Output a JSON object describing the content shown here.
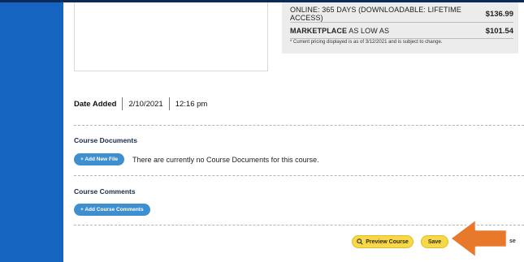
{
  "pricing": {
    "rows": [
      {
        "label_bold": "",
        "label": "ONLINE: 365 DAYS (DOWNLOADABLE: LIFETIME ACCESS)",
        "amount": "$136.99"
      },
      {
        "label_bold": "MARKETPLACE",
        "label": " AS LOW AS",
        "amount": "$101.54"
      }
    ],
    "note": "* Current pricing displayed is as of 3/12/2021 and is subject to change."
  },
  "date_added": {
    "label": "Date Added",
    "date": "2/10/2021",
    "time": "12:16 pm"
  },
  "documents": {
    "title": "Course Documents",
    "add_button": "+ Add New File",
    "empty_text": "There are currently no Course Documents for this course."
  },
  "comments": {
    "title": "Course Comments",
    "add_button": "+ Add Course Comments"
  },
  "footer": {
    "preview_label": "Preview Course",
    "save_label": "Save",
    "cut_label": "se"
  },
  "colors": {
    "sidebar": "#1565c0",
    "button_blue": "#3d8fcf",
    "button_yellow": "#f6d84a",
    "arrow": "#e8782a"
  },
  "icons": {
    "preview": "search-icon",
    "pointer": "arrow-icon"
  }
}
